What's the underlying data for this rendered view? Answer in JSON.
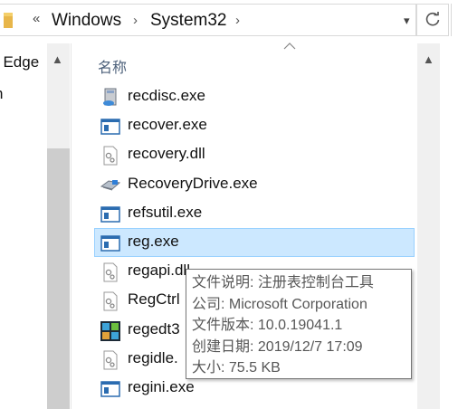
{
  "address_bar": {
    "overflow_symbol": "«",
    "crumbs": [
      "Windows",
      "System32"
    ],
    "separator": "›",
    "dropdown_symbol": "▾"
  },
  "nav_pane": {
    "items": [
      "t Edge",
      "n"
    ]
  },
  "file_list": {
    "column_header": "名称",
    "files": [
      {
        "name": "recdisc.exe",
        "icon": "recdisc-exe-icon"
      },
      {
        "name": "recover.exe",
        "icon": "console-exe-icon"
      },
      {
        "name": "recovery.dll",
        "icon": "dll-gear-icon"
      },
      {
        "name": "RecoveryDrive.exe",
        "icon": "recovery-drive-icon"
      },
      {
        "name": "refsutil.exe",
        "icon": "console-exe-icon"
      },
      {
        "name": "reg.exe",
        "icon": "console-exe-icon",
        "selected": true
      },
      {
        "name": "regapi.dll",
        "icon": "dll-gear-icon"
      },
      {
        "name": "RegCtrl",
        "icon": "dll-gear-icon"
      },
      {
        "name": "regedt3",
        "icon": "regedit-icon"
      },
      {
        "name": "regidle.",
        "icon": "dll-gear-icon"
      },
      {
        "name": "regini.exe",
        "icon": "console-exe-icon"
      }
    ]
  },
  "tooltip": {
    "lines": [
      "文件说明: 注册表控制台工具",
      "公司: Microsoft Corporation",
      "文件版本: 10.0.19041.1",
      "创建日期: 2019/12/7 17:09",
      "大小: 75.5 KB"
    ]
  },
  "colors": {
    "selection_bg": "#cce8ff",
    "selection_border": "#99d1ff",
    "header_text": "#4c607a",
    "scrollbar_bg": "#f0f0f0"
  }
}
